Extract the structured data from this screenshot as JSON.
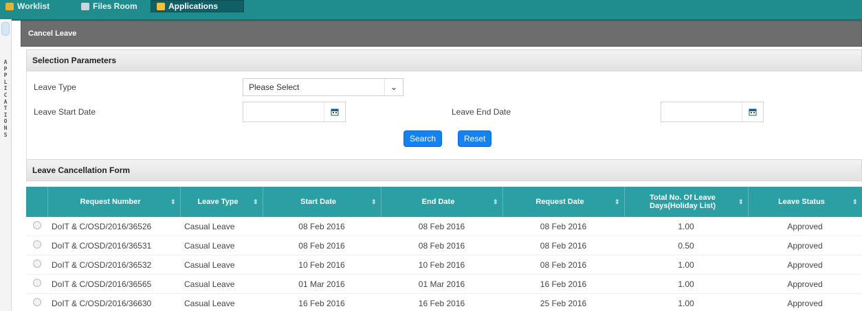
{
  "topnav": {
    "tabs": [
      {
        "label": "Worklist",
        "icon": "worklist-icon",
        "active": false
      },
      {
        "label": "Files Room",
        "icon": "files-room-icon",
        "active": false
      },
      {
        "label": "Applications",
        "icon": "applications-icon",
        "active": true
      }
    ]
  },
  "sidebar": {
    "vertical_label": "APPLICATIONS"
  },
  "page": {
    "title": "Cancel Leave"
  },
  "selection": {
    "heading": "Selection Parameters",
    "leave_type_label": "Leave Type",
    "leave_type_value": "Please Select",
    "start_date_label": "Leave Start Date",
    "start_date_value": "",
    "end_date_label": "Leave End Date",
    "end_date_value": "",
    "search_label": "Search",
    "reset_label": "Reset"
  },
  "form": {
    "heading": "Leave Cancellation Form",
    "columns": [
      "",
      "Request Number",
      "Leave Type",
      "Start Date",
      "End Date",
      "Request Date",
      "Total No. Of Leave Days(Holiday List)",
      "Leave Status"
    ],
    "rows": [
      [
        "DoIT & C/OSD/2016/36526",
        "Casual Leave",
        "08 Feb 2016",
        "08 Feb 2016",
        "08 Feb 2016",
        "1.00",
        "Approved"
      ],
      [
        "DoIT & C/OSD/2016/36531",
        "Casual Leave",
        "08 Feb 2016",
        "08 Feb 2016",
        "08 Feb 2016",
        "0.50",
        "Approved"
      ],
      [
        "DoIT & C/OSD/2016/36532",
        "Casual Leave",
        "10 Feb 2016",
        "10 Feb 2016",
        "08 Feb 2016",
        "1.00",
        "Approved"
      ],
      [
        "DoIT & C/OSD/2016/36565",
        "Casual Leave",
        "01 Mar 2016",
        "01 Mar 2016",
        "16 Feb 2016",
        "1.00",
        "Approved"
      ],
      [
        "DoIT & C/OSD/2016/36630",
        "Casual Leave",
        "16 Feb 2016",
        "16 Feb 2016",
        "25 Feb 2016",
        "1.00",
        "Approved"
      ]
    ]
  },
  "colors": {
    "nav_bg": "#1f8d8d",
    "title_bar": "#6d6d6d",
    "table_header": "#2c9fa4",
    "button": "#1483f0"
  }
}
